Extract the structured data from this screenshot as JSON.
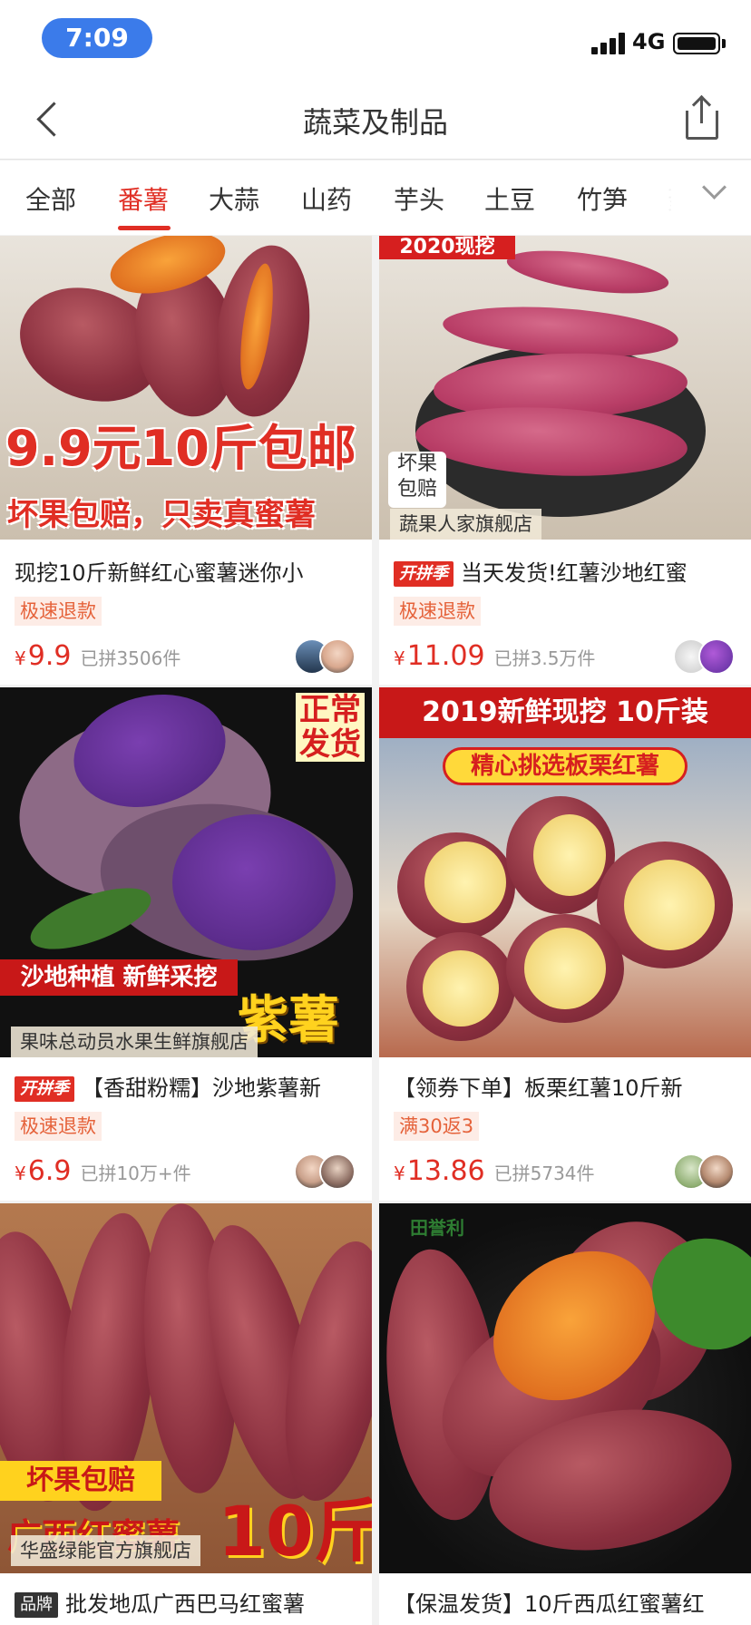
{
  "status_bar": {
    "time": "7:09",
    "network": "4G"
  },
  "nav": {
    "title": "蔬菜及制品"
  },
  "tabs": [
    {
      "label": "全部",
      "active": false
    },
    {
      "label": "番薯",
      "active": true
    },
    {
      "label": "大蒜",
      "active": false
    },
    {
      "label": "山药",
      "active": false
    },
    {
      "label": "芋头",
      "active": false
    },
    {
      "label": "土豆",
      "active": false
    },
    {
      "label": "竹笋",
      "active": false
    },
    {
      "label": "菱",
      "active": false
    }
  ],
  "colors": {
    "accent": "#e02e24",
    "promo_bg": "#fdece6",
    "promo_text": "#e5623a",
    "status_pill": "#3b7bea"
  },
  "products": [
    {
      "img_text": [
        "9.9元10斤包邮",
        "坏果包赔，只卖真蜜薯"
      ],
      "title": "现挖10斤新鲜红心蜜薯迷你小",
      "promo": "极速退款",
      "price": "9.9",
      "sold": "已拼3506件"
    },
    {
      "img_text": [
        "2020现挖",
        "坏果",
        "包赔"
      ],
      "shop": "蔬果人家旗舰店",
      "badge": "开拼季",
      "title": "当天发货!红薯沙地红蜜",
      "promo": "极速退款",
      "price": "11.09",
      "sold": "已拼3.5万件"
    },
    {
      "img_text": [
        "正常",
        "发货",
        "沙地种植 新鲜采挖",
        "紫薯"
      ],
      "shop": "果味总动员水果生鲜旗舰店",
      "badge": "开拼季",
      "title": "【香甜粉糯】沙地紫薯新",
      "promo": "极速退款",
      "price": "6.9",
      "sold": "已拼10万+件"
    },
    {
      "img_text": [
        "2019新鲜现挖  10斤装",
        "精心挑选板栗红薯"
      ],
      "title": "【领券下单】板栗红薯10斤新",
      "promo": "满30返3",
      "price": "13.86",
      "sold": "已拼5734件"
    },
    {
      "img_text": [
        "坏果包赔",
        "广西红蜜薯",
        "10斤"
      ],
      "shop": "华盛绿能官方旗舰店",
      "badge": "品牌",
      "title": "批发地瓜广西巴马红蜜薯"
    },
    {
      "img_text": [
        "田誉利"
      ],
      "title": "【保温发货】10斤西瓜红蜜薯红"
    }
  ],
  "currency": "¥"
}
